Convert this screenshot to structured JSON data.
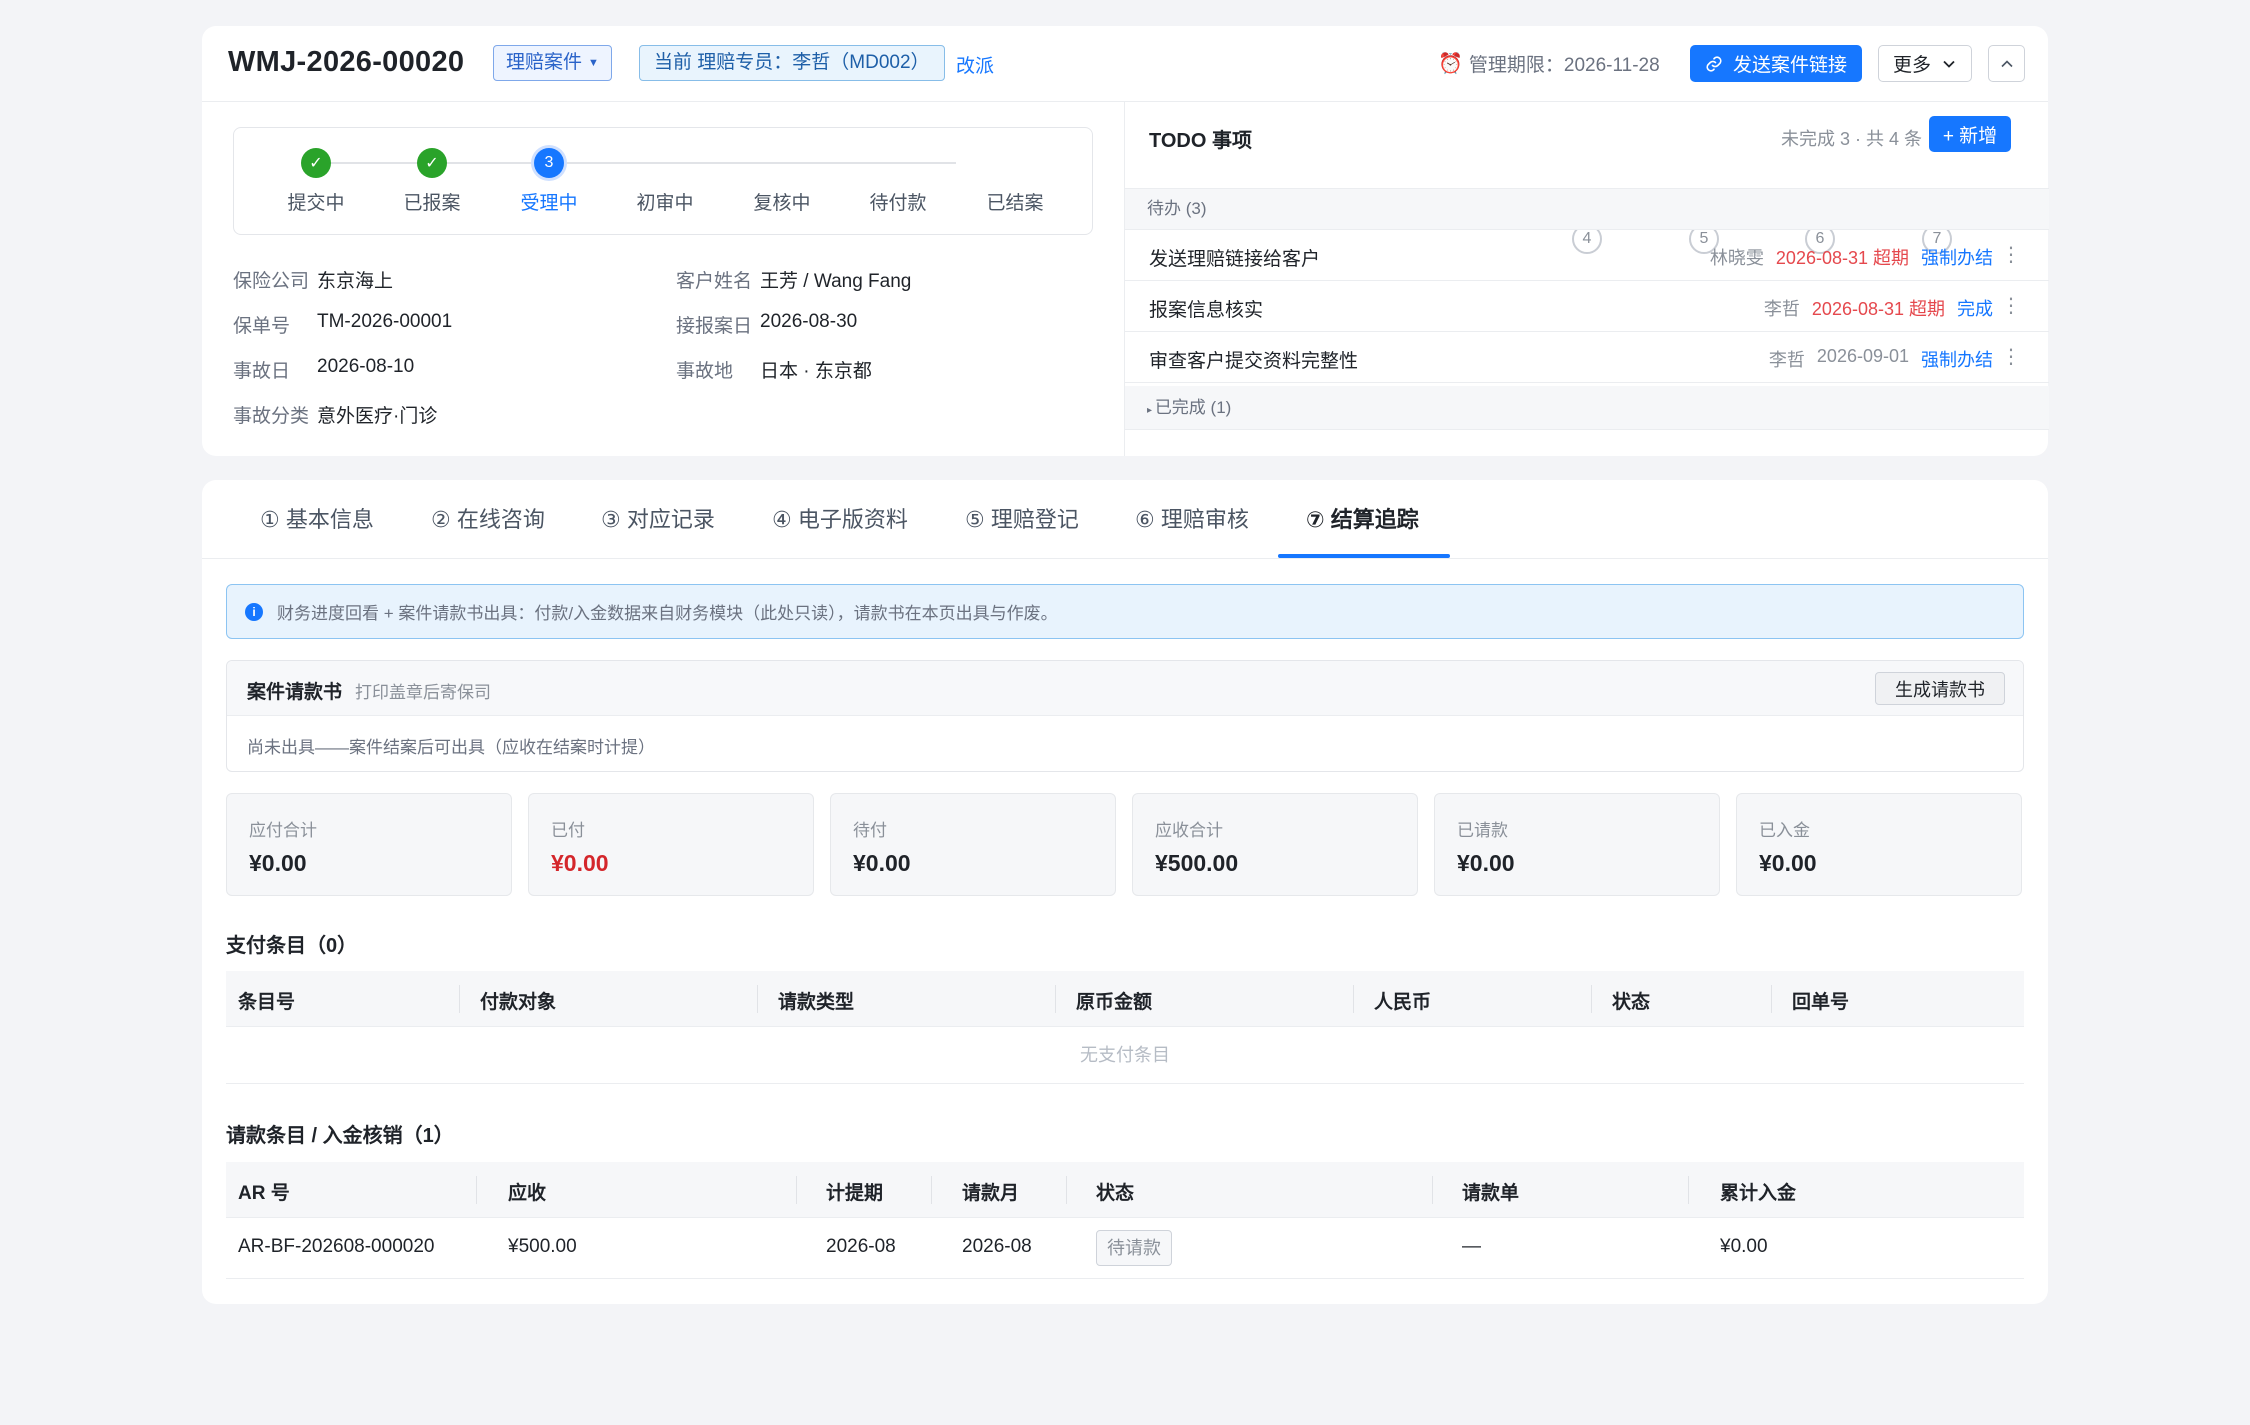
{
  "header": {
    "case_id": "WMJ-2026-00020",
    "case_type": "理赔案件",
    "current_owner": "当前 理赔专员：李哲（MD002）",
    "reassign": "改派",
    "deadline": "管理期限：2026-11-28",
    "send_link": "发送案件链接",
    "more": "更多"
  },
  "steps": [
    {
      "label": "提交中",
      "state": "done",
      "num": "1"
    },
    {
      "label": "已报案",
      "state": "done",
      "num": "2"
    },
    {
      "label": "受理中",
      "state": "current",
      "num": "3"
    },
    {
      "label": "初审中",
      "state": "todo",
      "num": "4"
    },
    {
      "label": "复核中",
      "state": "todo",
      "num": "5"
    },
    {
      "label": "待付款",
      "state": "todo",
      "num": "6"
    },
    {
      "label": "已结案",
      "state": "todo",
      "num": "7"
    }
  ],
  "info": {
    "insurer": {
      "k": "保险公司",
      "v": "东京海上"
    },
    "policy": {
      "k": "保单号",
      "v": "TM-2026-00001"
    },
    "accident_date": {
      "k": "事故日",
      "v": "2026-08-10"
    },
    "category": {
      "k": "事故分类",
      "v": "意外医疗·门诊"
    },
    "customer": {
      "k": "客户姓名",
      "v": "王芳 / Wang Fang"
    },
    "report_date": {
      "k": "接报案日",
      "v": "2026-08-30"
    },
    "location": {
      "k": "事故地",
      "v": "日本 · 东京都"
    }
  },
  "todo": {
    "title": "TODO 事项",
    "count": "未完成 3 · 共 4 条",
    "add": "+ 新增",
    "pending_group": "待办 (3)",
    "items": [
      {
        "title": "发送理赔链接给客户",
        "who": "林晓雯",
        "date": "2026-08-31 超期",
        "overdue": true,
        "action": "强制办结"
      },
      {
        "title": "报案信息核实",
        "who": "李哲",
        "date": "2026-08-31 超期",
        "overdue": true,
        "action": "完成"
      },
      {
        "title": "审查客户提交资料完整性",
        "who": "李哲",
        "date": "2026-09-01",
        "overdue": false,
        "action": "强制办结"
      }
    ],
    "done_group": "已完成 (1)"
  },
  "tabs": [
    {
      "label": "① 基本信息"
    },
    {
      "label": "② 在线咨询"
    },
    {
      "label": "③ 对应记录"
    },
    {
      "label": "④ 电子版资料"
    },
    {
      "label": "⑤ 理赔登记"
    },
    {
      "label": "⑥ 理赔审核"
    },
    {
      "label": "⑦ 结算追踪",
      "active": true
    }
  ],
  "banner": "财务进度回看 + 案件请款书出具：付款/入金数据来自财务模块（此处只读），请款书在本页出具与作废。",
  "request_letter": {
    "title": "案件请款书",
    "subtitle": "打印盖章后寄保司",
    "generate": "生成请款书",
    "body": "尚未出具——案件结案后可出具（应收在结案时计提）"
  },
  "stats": [
    {
      "label": "应付合计",
      "value": "¥0.00"
    },
    {
      "label": "已付",
      "value": "¥0.00",
      "highlight": "#d4262b"
    },
    {
      "label": "待付",
      "value": "¥0.00"
    },
    {
      "label": "应收合计",
      "value": "¥500.00"
    },
    {
      "label": "已请款",
      "value": "¥0.00"
    },
    {
      "label": "已入金",
      "value": "¥0.00"
    }
  ],
  "payments": {
    "title": "支付条目（0）",
    "columns": [
      "条目号",
      "付款对象",
      "请款类型",
      "原币金额",
      "人民币",
      "状态",
      "回单号"
    ],
    "empty": "无支付条目"
  },
  "receivables": {
    "title": "请款条目 / 入金核销（1）",
    "columns": [
      "AR 号",
      "应收",
      "计提期",
      "请款月",
      "状态",
      "请款单",
      "累计入金"
    ],
    "rows": [
      {
        "ar": "AR-BF-202608-000020",
        "amount": "¥500.00",
        "period": "2026-08",
        "month": "2026-08",
        "status": "待请款",
        "invoice": "—",
        "received": "¥0.00"
      }
    ]
  },
  "colors": {
    "accent": "#1677ff",
    "success": "#2aa32a",
    "danger": "#e5484d"
  }
}
